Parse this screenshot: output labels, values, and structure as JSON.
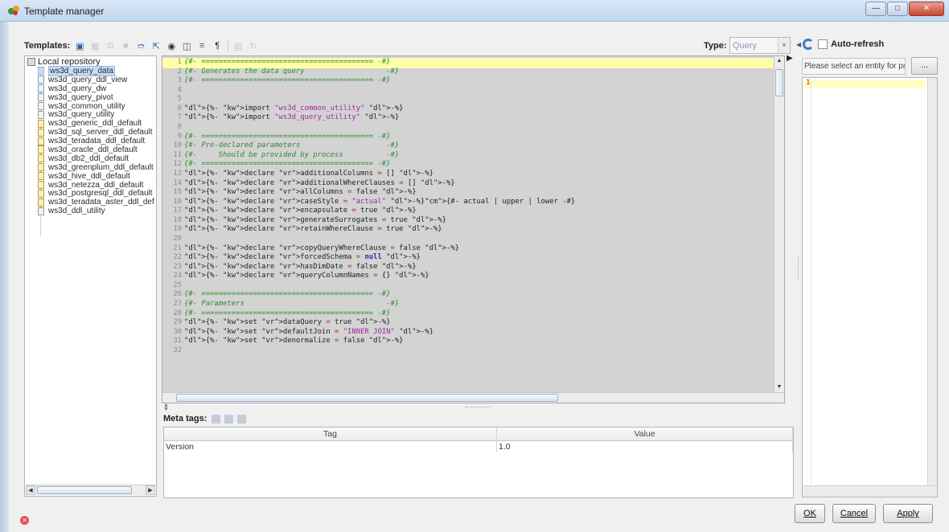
{
  "window": {
    "title": "Template manager"
  },
  "toolbar": {
    "templates_label": "Templates:"
  },
  "type": {
    "label": "Type:",
    "value": "Query"
  },
  "auto_refresh": {
    "label": "Auto-refresh",
    "checked": false
  },
  "tree": {
    "root": "Local repository",
    "items": [
      {
        "label": "ws3d_query_data",
        "selected": true
      },
      {
        "label": "ws3d_query_ddl_view"
      },
      {
        "label": "ws3d_query_dw"
      },
      {
        "label": "ws3d_query_pivot"
      },
      {
        "label": "ws3d_common_utility"
      },
      {
        "label": "ws3d_query_utility"
      },
      {
        "label": "ws3d_generic_ddl_default"
      },
      {
        "label": "ws3d_sql_server_ddl_default"
      },
      {
        "label": "ws3d_teradata_ddl_default"
      },
      {
        "label": "ws3d_oracle_ddl_default"
      },
      {
        "label": "ws3d_db2_ddl_default"
      },
      {
        "label": "ws3d_greenplum_ddl_default"
      },
      {
        "label": "ws3d_hive_ddl_default"
      },
      {
        "label": "ws3d_netezza_ddl_default"
      },
      {
        "label": "ws3d_postgresql_ddl_default"
      },
      {
        "label": "ws3d_teradata_aster_ddl_def"
      },
      {
        "label": "ws3d_ddl_utility"
      }
    ]
  },
  "editor": {
    "lines": [
      "{#- ======================================== -#}",
      "{#- Generates the data query                   -#}",
      "{#- ======================================== -#}",
      "",
      "",
      "{%- import \"ws3d_common_utility\" -%}",
      "{%- import \"ws3d_query_utility\" -%}",
      "",
      "{#- ======================================== -#}",
      "{#- Pre-declared parameters                    -#}",
      "{#-     Should be provided by process          -#}",
      "{#- ======================================== -#}",
      "{%- declare additionalColumns = [] -%}",
      "{%- declare additionalWhereClauses = [] -%}",
      "{%- declare allColumns = false -%}",
      "{%- declare caseStyle = \"actual\" -%}{#- actual | upper | lower -#}",
      "{%- declare encapsulate = true -%}",
      "{%- declare generateSurrogates = true -%}",
      "{%- declare retainWhereClause = true -%}",
      "",
      "{%- declare copyQueryWhereClause = false -%}",
      "{%- declare forcedSchema = null -%}",
      "{%- declare hasDimDate = false -%}",
      "{%- declare queryColumnNames = {} -%}",
      "",
      "{#- ======================================== -#}",
      "{#- Parameters                                 -#}",
      "{#- ======================================== -#}",
      "{%- set dataQuery = true -%}",
      "{%- set defaultJoin = \"INNER JOIN\" -%}",
      "{%- set denormalize = false -%}",
      ""
    ]
  },
  "meta": {
    "label": "Meta tags:",
    "columns": [
      "Tag",
      "Value"
    ],
    "rows": [
      {
        "tag": "Version",
        "value": "1.0"
      }
    ]
  },
  "right_panel": {
    "entity_placeholder": "Please select an entity for preview",
    "browse_label": "...",
    "line_number": "1"
  },
  "buttons": {
    "ok": "OK",
    "cancel": "Cancel",
    "apply": "Apply"
  }
}
